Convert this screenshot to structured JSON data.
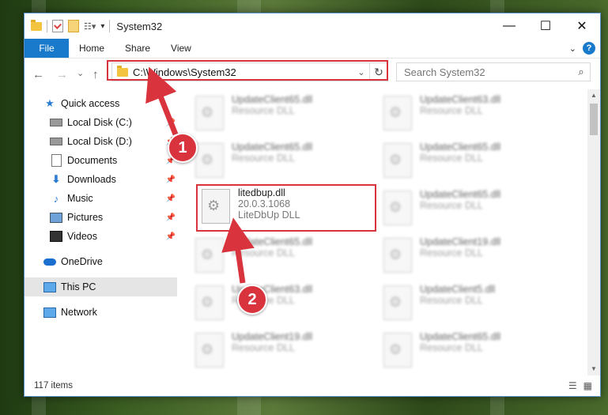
{
  "window": {
    "title": "System32",
    "controls": {
      "minimize": "—",
      "maximize": "☐",
      "close": "✕"
    }
  },
  "ribbon": {
    "tabs": [
      {
        "label": "File"
      },
      {
        "label": "Home"
      },
      {
        "label": "Share"
      },
      {
        "label": "View"
      }
    ],
    "help": "?"
  },
  "navigation": {
    "back": "←",
    "forward": "→",
    "recent": "⌄",
    "up": "↑",
    "address": "C:\\Windows\\System32",
    "search_placeholder": "Search System32"
  },
  "sidebar": {
    "items": [
      {
        "label": "Quick access"
      },
      {
        "label": "Local Disk (C:)"
      },
      {
        "label": "Local Disk (D:)"
      },
      {
        "label": "Documents"
      },
      {
        "label": "Downloads"
      },
      {
        "label": "Music"
      },
      {
        "label": "Pictures"
      },
      {
        "label": "Videos"
      },
      {
        "label": "OneDrive"
      },
      {
        "label": "This PC"
      },
      {
        "label": "Network"
      }
    ]
  },
  "files": [
    {
      "name": "UpdateClient65.dll",
      "line2": "Resource DLL"
    },
    {
      "name": "UpdateClient63.dll",
      "line2": "Resource DLL"
    },
    {
      "name": "UpdateClient65.dll",
      "line2": "Resource DLL"
    },
    {
      "name": "UpdateClient65.dll",
      "line2": "Resource DLL"
    },
    {
      "name": "litedbup.dll",
      "line2": "20.0.3.1068",
      "line3": "LiteDbUp DLL"
    },
    {
      "name": "UpdateClient65.dll",
      "line2": "Resource DLL"
    },
    {
      "name": "UpdateClient65.dll",
      "line2": "Resource DLL"
    },
    {
      "name": "UpdateClient19.dll",
      "line2": "Resource DLL"
    },
    {
      "name": "UpdateClient63.dll",
      "line2": "Resource DLL"
    },
    {
      "name": "UpdateClient5.dll",
      "line2": "Resource DLL"
    },
    {
      "name": "UpdateClient19.dll",
      "line2": "Resource DLL"
    },
    {
      "name": "UpdateClient65.dll",
      "line2": "Resource DLL"
    }
  ],
  "status": {
    "count": "117 items"
  },
  "annotations": {
    "step1": "1",
    "step2": "2",
    "highlight_color": "#d9343d"
  }
}
